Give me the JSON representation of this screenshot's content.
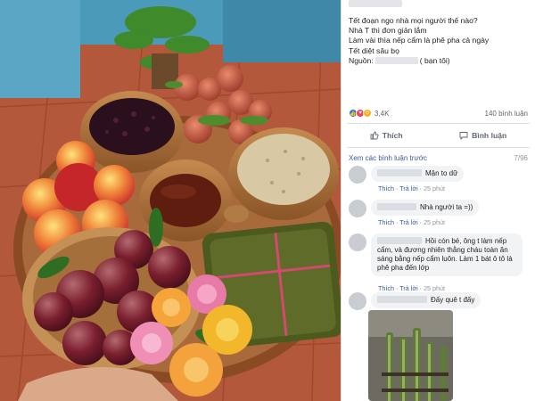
{
  "post": {
    "lines": [
      "Tết đoạn ngo nhà mọi người thế nào?",
      "Nhà T thì đơn giản lắm",
      "Làm vài thìa nếp cẩm là phê pha cả ngày",
      "Tết diệt sâu bọ"
    ],
    "source_label": "Nguồn:",
    "source_suffix": "( bạn tôi)"
  },
  "reactions": {
    "count": "3,4K",
    "types": [
      "like-icon",
      "love-icon",
      "haha-icon"
    ],
    "comments_count": "140 bình luận"
  },
  "actions": {
    "like_label": "Thích",
    "comment_label": "Bình luận"
  },
  "comments_section": {
    "see_previous": "Xem các bình luận trước",
    "index": "7/96"
  },
  "comments": [
    {
      "text": "Mận to dữ",
      "like": "Thích",
      "reply": "Trả lời",
      "time": "25 phút"
    },
    {
      "text": "Nhà người ta =))",
      "like": "Thích",
      "reply": "Trả lời",
      "time": "25 phút"
    },
    {
      "text": "Hồi còn bé, ông t làm nếp cẩm, và đương nhiên thằng cháu toàn ăn sáng bằng nếp cẩm luôn. Làm 1 bát ô tô là phê pha đến lớp",
      "like": "Thích",
      "reply": "Trả lời",
      "time": "25 phút"
    },
    {
      "text": "Đấy quê t đấy",
      "like": "",
      "reply": "",
      "time": ""
    }
  ],
  "colors": {
    "link": "#385898",
    "like": "#1877f2",
    "love": "#f33e58",
    "haha": "#f7b125",
    "bubble": "#f2f3f5"
  }
}
